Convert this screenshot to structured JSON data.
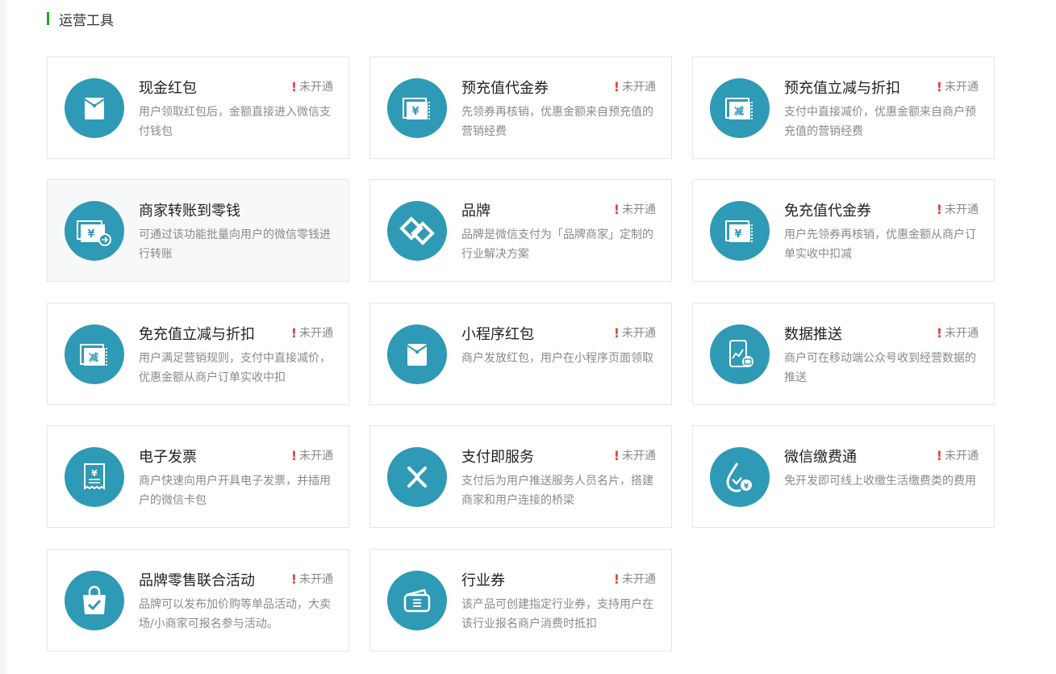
{
  "section": {
    "title": "运营工具"
  },
  "status_text": "未开通",
  "accent_color": "#2e9ab5",
  "warn_color": "#e64340",
  "cards": [
    {
      "title": "现金红包",
      "status": "未开通",
      "desc": "用户领取红包后，金额直接进入微信支付钱包",
      "icon": "red-envelope-icon"
    },
    {
      "title": "预充值代金券",
      "status": "未开通",
      "desc": "先领券再核销，优惠金额来自预充值的营销经费",
      "icon": "yuan-coupon-icon"
    },
    {
      "title": "预充值立减与折扣",
      "status": "未开通",
      "desc": "支付中直接减价，优惠金额来自商户预充值的营销经费",
      "icon": "discount-coupon-icon"
    },
    {
      "title": "商家转账到零钱",
      "status": "",
      "desc": "可通过该功能批量向用户的微信零钱进行转账",
      "icon": "transfer-icon"
    },
    {
      "title": "品牌",
      "status": "未开通",
      "desc": "品牌是微信支付为「品牌商家」定制的行业解决方案",
      "icon": "brand-icon"
    },
    {
      "title": "免充值代金券",
      "status": "未开通",
      "desc": "用户先领券再核销，优惠金额从商户订单实收中扣减",
      "icon": "yuan-coupon-icon"
    },
    {
      "title": "免充值立减与折扣",
      "status": "未开通",
      "desc": "用户满足营销规则，支付中直接减价，优惠金额从商户订单实收中扣",
      "icon": "discount-coupon-icon"
    },
    {
      "title": "小程序红包",
      "status": "未开通",
      "desc": "商户发放红包，用户在小程序页面领取",
      "icon": "red-envelope-icon"
    },
    {
      "title": "数据推送",
      "status": "未开通",
      "desc": "商户可在移动端公众号收到经营数据的推送",
      "icon": "data-push-icon"
    },
    {
      "title": "电子发票",
      "status": "未开通",
      "desc": "商户快速向用户开具电子发票，并插用户的微信卡包",
      "icon": "invoice-icon"
    },
    {
      "title": "支付即服务",
      "status": "未开通",
      "desc": "支付后为用户推送服务人员名片，搭建商家和用户连接的桥梁",
      "icon": "service-link-icon"
    },
    {
      "title": "微信缴费通",
      "status": "未开通",
      "desc": "免开发即可线上收缴生活缴费类的费用",
      "icon": "bill-pay-icon"
    },
    {
      "title": "品牌零售联合活动",
      "status": "未开通",
      "desc": "品牌可以发布加价购等单品活动，大卖场/小商家可报名参与活动。",
      "icon": "shopping-bag-icon"
    },
    {
      "title": "行业券",
      "status": "未开通",
      "desc": "该产品可创建指定行业券，支持用户在该行业报名商户消费时抵扣",
      "icon": "wallet-icon"
    }
  ]
}
